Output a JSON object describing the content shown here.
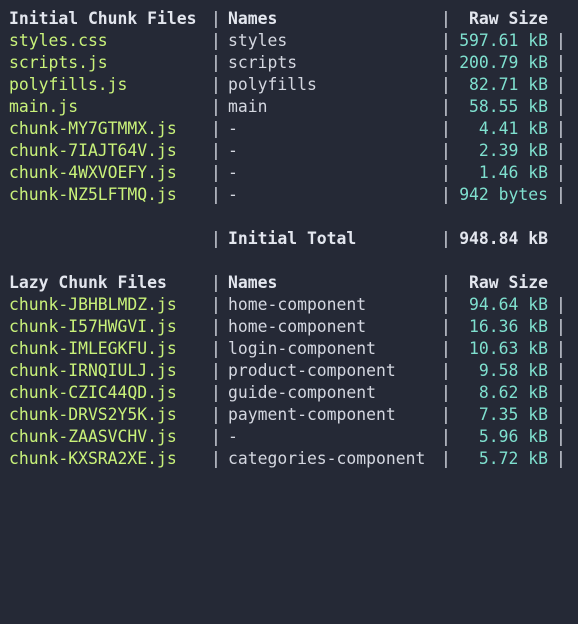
{
  "initial": {
    "header": {
      "files": "Initial Chunk Files",
      "names": "Names",
      "size": "Raw Size"
    },
    "rows": [
      {
        "file": "styles.css",
        "name": "styles",
        "size": "597.61 kB"
      },
      {
        "file": "scripts.js",
        "name": "scripts",
        "size": "200.79 kB"
      },
      {
        "file": "polyfills.js",
        "name": "polyfills",
        "size": "82.71 kB"
      },
      {
        "file": "main.js",
        "name": "main",
        "size": "58.55 kB"
      },
      {
        "file": "chunk-MY7GTMMX.js",
        "name": "-",
        "size": "4.41 kB"
      },
      {
        "file": "chunk-7IAJT64V.js",
        "name": "-",
        "size": "2.39 kB"
      },
      {
        "file": "chunk-4WXVOEFY.js",
        "name": "-",
        "size": "1.46 kB"
      },
      {
        "file": "chunk-NZ5LFTMQ.js",
        "name": "-",
        "size": "942 bytes"
      }
    ],
    "total_label": "Initial Total",
    "total_size": "948.84 kB"
  },
  "lazy": {
    "header": {
      "files": "Lazy Chunk Files",
      "names": "Names",
      "size": "Raw Size"
    },
    "rows": [
      {
        "file": "chunk-JBHBLMDZ.js",
        "name": "home-component",
        "size": "94.64 kB"
      },
      {
        "file": "chunk-I57HWGVI.js",
        "name": "home-component",
        "size": "16.36 kB"
      },
      {
        "file": "chunk-IMLEGKFU.js",
        "name": "login-component",
        "size": "10.63 kB"
      },
      {
        "file": "chunk-IRNQIULJ.js",
        "name": "product-component",
        "size": "9.58 kB"
      },
      {
        "file": "chunk-CZIC44QD.js",
        "name": "guide-component",
        "size": "8.62 kB"
      },
      {
        "file": "chunk-DRVS2Y5K.js",
        "name": "payment-component",
        "size": "7.35 kB"
      },
      {
        "file": "chunk-ZAASVCHV.js",
        "name": "-",
        "size": "5.96 kB"
      },
      {
        "file": "chunk-KXSRA2XE.js",
        "name": "categories-component",
        "size": "5.72 kB"
      }
    ]
  },
  "separator": "|",
  "colors": {
    "background": "#252936",
    "file": "#c9f27a",
    "size": "#7fe0cf",
    "text": "#d4d7e0"
  }
}
